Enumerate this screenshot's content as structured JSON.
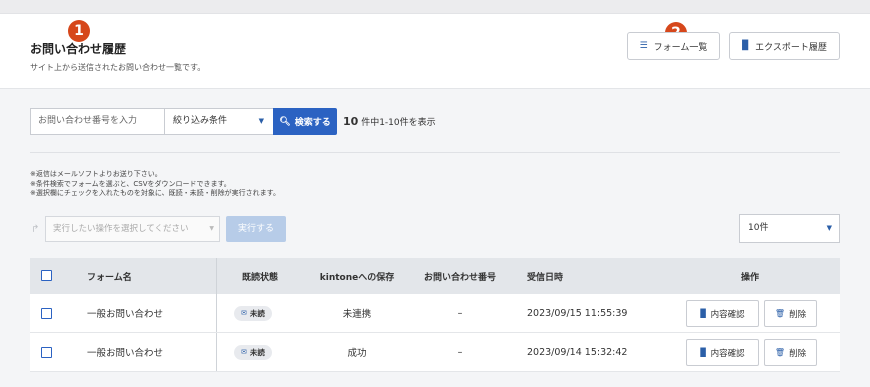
{
  "markers": {
    "one": "1",
    "two": "2"
  },
  "header": {
    "title": "お問い合わせ履歴",
    "subtitle": "サイト上から送信されたお問い合わせ一覧です。",
    "forms_button": "フォーム一覧",
    "export_button": "エクスポート履歴"
  },
  "search": {
    "placeholder": "お問い合わせ番号を入力",
    "filter_label": "絞り込み条件",
    "search_button": "検索する",
    "result_total": "10",
    "result_text": "件中1-10件を表示"
  },
  "notes": [
    "※返信はメールソフトよりお送り下さい。",
    "※条件検索でフォームを選ぶと、CSVをダウンロードできます。",
    "※選択欄にチェックを入れたものを対象に、既読・未読・削除が実行されます。"
  ],
  "bulk": {
    "action_placeholder": "実行したい操作を選択してください",
    "run_button": "実行する",
    "page_size": "10件"
  },
  "table": {
    "headers": {
      "form_name": "フォーム名",
      "read_status": "既読状態",
      "kintone": "kintoneへの保存",
      "inquiry_no": "お問い合わせ番号",
      "received": "受信日時",
      "actions": "操作"
    },
    "rows": [
      {
        "form_name": "一般お問い合わせ",
        "read_status": "未読",
        "kintone": "未連携",
        "inquiry_no": "–",
        "received": "2023/09/15 11:55:39",
        "view": "内容確認",
        "delete": "削除"
      },
      {
        "form_name": "一般お問い合わせ",
        "read_status": "未読",
        "kintone": "成功",
        "inquiry_no": "–",
        "received": "2023/09/14 15:32:42",
        "view": "内容確認",
        "delete": "削除"
      }
    ]
  },
  "colors": {
    "primary": "#2b62c2",
    "marker": "#d6471b",
    "disabled": "#b7cce8"
  }
}
